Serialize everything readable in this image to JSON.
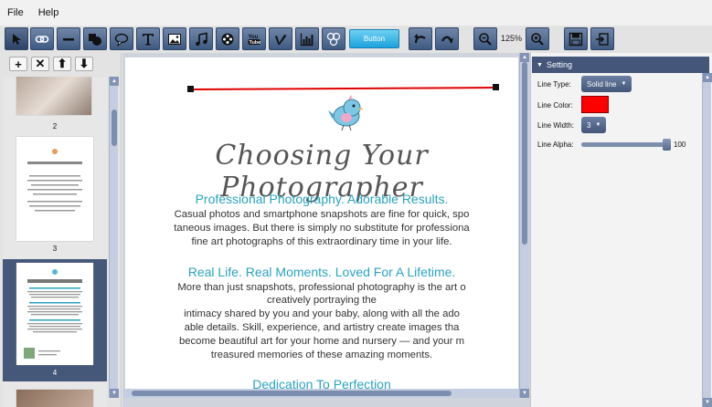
{
  "menu": {
    "file": "File",
    "help": "Help"
  },
  "toolbar": {
    "tools": [
      {
        "name": "select-tool",
        "icon": "arrow-pointer-icon"
      },
      {
        "name": "link-tool",
        "icon": "link-icon"
      },
      {
        "name": "line-tool",
        "icon": "line-icon"
      },
      {
        "name": "shape-tool",
        "icon": "shapes-icon"
      },
      {
        "name": "callout-tool",
        "icon": "speech-bubble-icon"
      },
      {
        "name": "text-tool",
        "icon": "text-icon"
      },
      {
        "name": "image-tool",
        "icon": "image-icon"
      },
      {
        "name": "audio-tool",
        "icon": "music-note-icon"
      },
      {
        "name": "video-tool",
        "icon": "film-reel-icon"
      },
      {
        "name": "youtube-tool",
        "icon": "youtube-icon"
      },
      {
        "name": "vimeo-tool",
        "icon": "vimeo-icon"
      },
      {
        "name": "chart-tool",
        "icon": "chart-icon"
      },
      {
        "name": "gallery-tool",
        "icon": "gallery-icon"
      }
    ],
    "button_label": "Button",
    "zoom_level": "125%"
  },
  "pages": {
    "thumbs": [
      {
        "number": "2",
        "selected": false
      },
      {
        "number": "3",
        "selected": false
      },
      {
        "number": "4",
        "selected": true
      }
    ],
    "add_label": "+",
    "delete_label": "✕",
    "up_label": "⬆",
    "down_label": "⬇"
  },
  "document": {
    "title": "Choosing Your Photographer",
    "heading1": "Professional Photography. Adorable Results.",
    "p1_l1": "Casual photos and smartphone snapshots are fine for quick, spo",
    "p1_l2": "taneous images. But there is simply no substitute for professiona",
    "p1_l3": "fine art photographs of this extraordinary time in your life.",
    "heading2": "Real Life. Real Moments. Loved For A Lifetime.",
    "p2_l1": "More than just snapshots, professional photography is the art o",
    "p2_l2": "creatively portraying the",
    "p2_l3": "intimacy shared by you and your baby, along with all the ado",
    "p2_l4": "able details. Skill, experience, and artistry create images tha",
    "p2_l5": "become beautiful art for your home and nursery — and your m",
    "p2_l6": "treasured memories of these amazing moments.",
    "heading3": "Dedication To Perfection"
  },
  "settings": {
    "header": "Setting",
    "line_type_label": "Line Type:",
    "line_type_value": "Solid line",
    "line_color_label": "Line Color:",
    "line_color_value": "#ff0000",
    "line_width_label": "Line Width:",
    "line_width_value": "3",
    "line_alpha_label": "Line Alpha:",
    "line_alpha_value": "100",
    "line_alpha_fraction": 1.0
  },
  "colors": {
    "accent": "#44577a",
    "heading": "#2aa3c0",
    "line": "#e00000"
  }
}
